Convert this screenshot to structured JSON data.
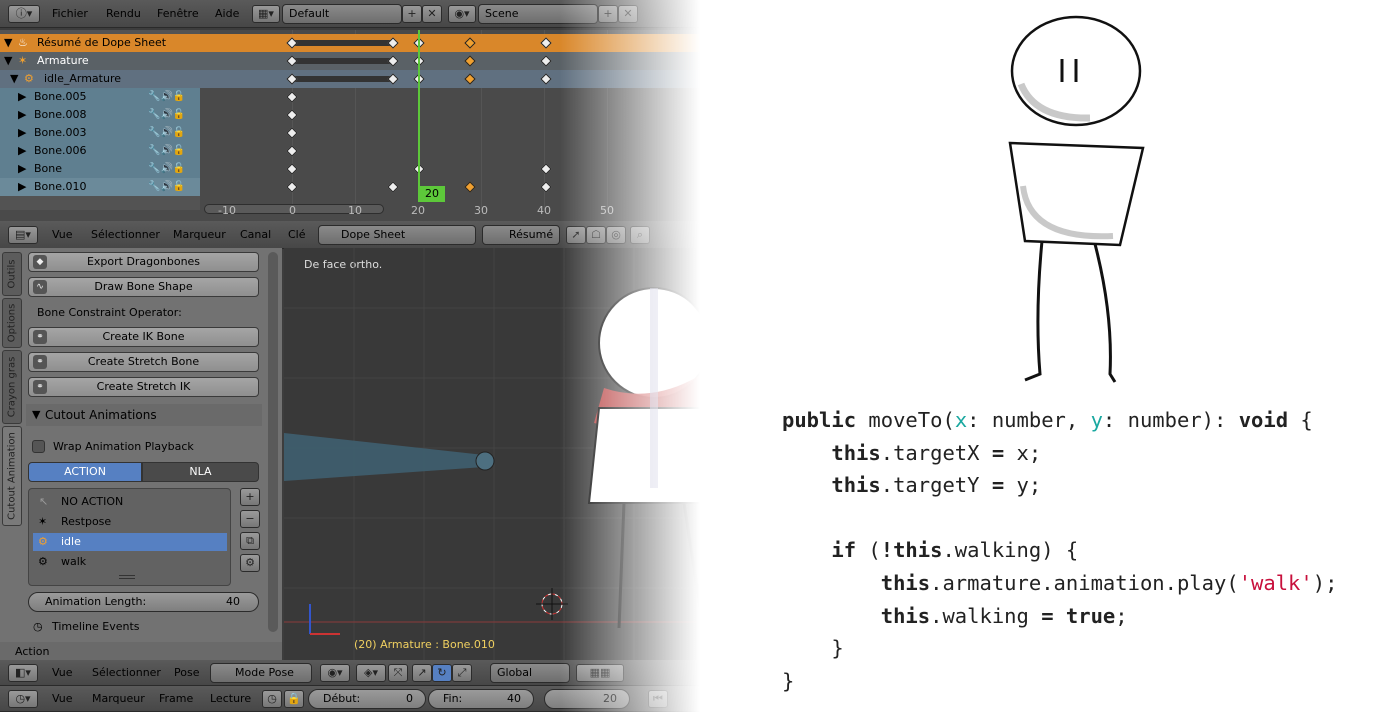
{
  "topbar": {
    "menus": [
      "Fichier",
      "Rendu",
      "Fenêtre",
      "Aide"
    ],
    "layout": "Default",
    "scene": "Scene"
  },
  "dopesheet": {
    "channels": [
      {
        "name": "Résumé de Dope Sheet",
        "kind": "summary"
      },
      {
        "name": "Armature",
        "kind": "object"
      },
      {
        "name": "idle_Armature",
        "kind": "action"
      },
      {
        "name": "Bone.005",
        "kind": "bone"
      },
      {
        "name": "Bone.008",
        "kind": "bone"
      },
      {
        "name": "Bone.003",
        "kind": "bone"
      },
      {
        "name": "Bone.006",
        "kind": "bone"
      },
      {
        "name": "Bone",
        "kind": "bone"
      },
      {
        "name": "Bone.010",
        "kind": "bone"
      }
    ],
    "ruler": [
      "-10",
      "0",
      "10",
      "20",
      "30",
      "40",
      "50"
    ],
    "current_frame": "20",
    "header": {
      "menus": [
        "Vue",
        "Sélectionner",
        "Marqueur",
        "Canal",
        "Clé"
      ],
      "mode": "Dope Sheet",
      "summary": "Résumé"
    }
  },
  "tools": {
    "tabs": [
      "Outils",
      "Options",
      "Crayon gras",
      "Cutout Animation"
    ],
    "export_btn": "Export Dragonbones",
    "draw_btn": "Draw Bone Shape",
    "constraint_label": "Bone Constraint Operator:",
    "ik_btn": "Create IK Bone",
    "stretch_bone_btn": "Create Stretch Bone",
    "stretch_ik_btn": "Create Stretch IK",
    "panel_title": "Cutout Animations",
    "wrap_label": "Wrap Animation Playback",
    "tab_action": "ACTION",
    "tab_nla": "NLA",
    "actions": [
      "NO ACTION",
      "Restpose",
      "idle",
      "walk"
    ],
    "selected_action": "idle",
    "anim_length_label": "Animation Length:",
    "anim_length_value": "40",
    "timeline_events": "Timeline Events",
    "footer": "Action"
  },
  "viewport": {
    "overlay": "De face ortho.",
    "status": "(20) Armature : Bone.010",
    "header": {
      "menus": [
        "Vue",
        "Sélectionner",
        "Pose"
      ],
      "mode": "Mode Pose",
      "orientation": "Global"
    }
  },
  "timeline": {
    "menus": [
      "Vue",
      "Marqueur",
      "Frame",
      "Lecture"
    ],
    "start_label": "Début:",
    "start_value": "0",
    "end_label": "Fin:",
    "end_value": "40",
    "current": "20"
  },
  "code": {
    "l1a": "public",
    "l1b": " moveTo(",
    "l1c": "x",
    "l1d": ": number, ",
    "l1e": "y",
    "l1f": ": number): ",
    "l1g": "void",
    "l1h": " {",
    "l2a": "    ",
    "l2b": "this",
    "l2c": ".targetX ",
    "l2d": "=",
    "l2e": " x;",
    "l3a": "    ",
    "l3b": "this",
    "l3c": ".targetY ",
    "l3d": "=",
    "l3e": " y;",
    "l5a": "    ",
    "l5b": "if",
    "l5c": " (",
    "l5d": "!this",
    "l5e": ".walking) {",
    "l6a": "        ",
    "l6b": "this",
    "l6c": ".armature.animation.play(",
    "l6d": "'walk'",
    "l6e": ");",
    "l7a": "        ",
    "l7b": "this",
    "l7c": ".walking ",
    "l7d": "=",
    "l7e": " ",
    "l7f": "true",
    "l7g": ";",
    "l8": "    }",
    "l9": "}"
  }
}
